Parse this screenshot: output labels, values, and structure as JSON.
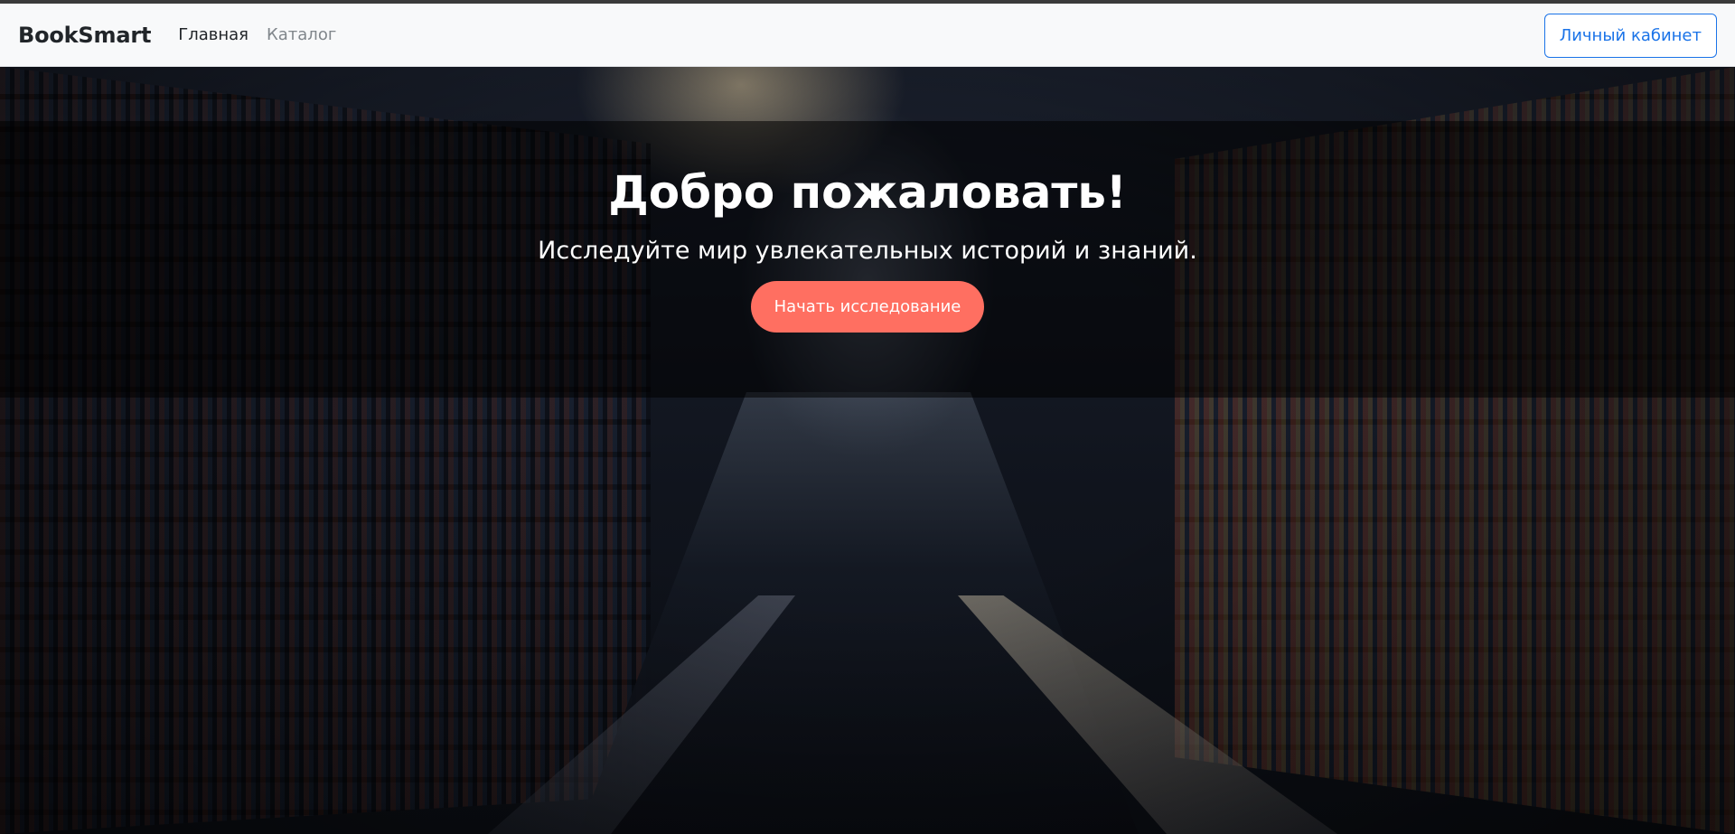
{
  "navbar": {
    "brand": "BookSmart",
    "links": [
      {
        "label": "Главная",
        "active": true
      },
      {
        "label": "Каталог",
        "active": false
      }
    ],
    "account_button": "Личный кабинет"
  },
  "hero": {
    "title": "Добро пожаловать!",
    "subtitle": "Исследуйте мир увлекательных историй и знаний.",
    "cta_label": "Начать исследование"
  },
  "colors": {
    "accent": "#ff6f61",
    "link_blue": "#1a73e8",
    "navbar_bg": "#f8f9fa"
  }
}
